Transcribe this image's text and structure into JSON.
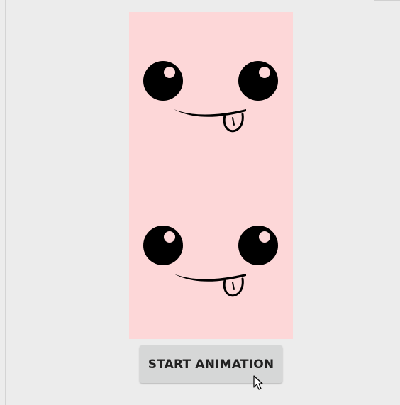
{
  "button": {
    "label": "START ANIMATION"
  },
  "colors": {
    "background": "#ececec",
    "canvas": "#fdd7d8",
    "button": "#d6d7d7",
    "button_text": "#212121",
    "face_ink": "#000000"
  },
  "icons": {
    "face": "emoji-tongue-face",
    "cursor": "mouse-pointer"
  }
}
